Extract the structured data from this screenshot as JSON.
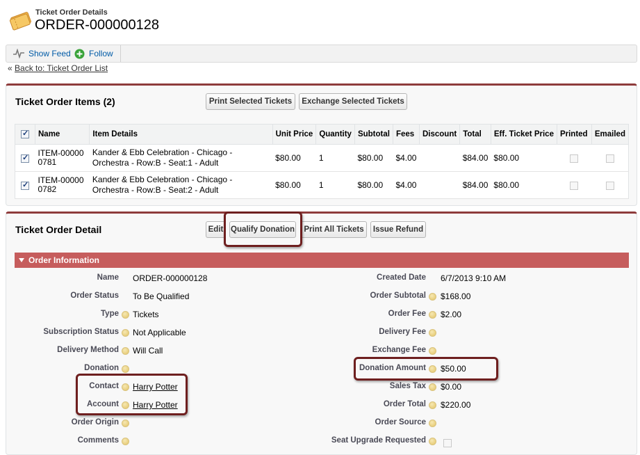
{
  "header": {
    "subtitle": "Ticket Order Details",
    "title": "ORDER-000000128"
  },
  "feedbar": {
    "show_feed": "Show Feed",
    "follow": "Follow"
  },
  "back_link": {
    "prefix": "« ",
    "label": "Back to: Ticket Order List"
  },
  "items_panel": {
    "title": "Ticket Order Items (2)",
    "print_button": "Print Selected Tickets",
    "exchange_button": "Exchange Selected Tickets",
    "columns": [
      "Name",
      "Item Details",
      "Unit Price",
      "Quantity",
      "Subtotal",
      "Fees",
      "Discount",
      "Total",
      "Eff. Ticket Price",
      "Printed",
      "Emailed"
    ],
    "rows": [
      {
        "name": "ITEM-000000781",
        "details": "Kander & Ebb Celebration - Chicago - Orchestra - Row:B - Seat:1 - Adult",
        "unit_price": "$80.00",
        "quantity": "1",
        "subtotal": "$80.00",
        "fees": "$4.00",
        "discount": "",
        "total": "$84.00",
        "eff_price": "$80.00"
      },
      {
        "name": "ITEM-000000782",
        "details": "Kander & Ebb Celebration - Chicago - Orchestra - Row:B - Seat:2 - Adult",
        "unit_price": "$80.00",
        "quantity": "1",
        "subtotal": "$80.00",
        "fees": "$4.00",
        "discount": "",
        "total": "$84.00",
        "eff_price": "$80.00"
      }
    ]
  },
  "detail_panel": {
    "title": "Ticket Order Detail",
    "edit_button": "Edit",
    "qualify_button": "Qualify Donation",
    "print_all_button": "Print All Tickets",
    "refund_button": "Issue Refund",
    "section_title": "Order Information",
    "left_fields": [
      {
        "label": "Name",
        "value": "ORDER-000000128"
      },
      {
        "label": "Order Status",
        "value": "To Be Qualified"
      },
      {
        "label": "Type",
        "value": "Tickets"
      },
      {
        "label": "Subscription Status",
        "value": "Not Applicable"
      },
      {
        "label": "Delivery Method",
        "value": "Will Call"
      },
      {
        "label": "Donation",
        "value": ""
      },
      {
        "label": "Contact",
        "value": "Harry Potter"
      },
      {
        "label": "Account",
        "value": "Harry Potter"
      },
      {
        "label": "Order Origin",
        "value": ""
      },
      {
        "label": "Comments",
        "value": ""
      }
    ],
    "right_fields": [
      {
        "label": "Created Date",
        "value": "6/7/2013 9:10 AM"
      },
      {
        "label": "Order Subtotal",
        "value": "$168.00"
      },
      {
        "label": "Order Fee",
        "value": "$2.00"
      },
      {
        "label": "Delivery Fee",
        "value": ""
      },
      {
        "label": "Exchange Fee",
        "value": ""
      },
      {
        "label": "Donation Amount",
        "value": "$50.00"
      },
      {
        "label": "Sales Tax",
        "value": "$0.00"
      },
      {
        "label": "Order Total",
        "value": "$220.00"
      },
      {
        "label": "Order Source",
        "value": ""
      },
      {
        "label": "Seat Upgrade Requested",
        "value": ""
      }
    ]
  },
  "colors": {
    "accent": "#8e3b3b",
    "section_header": "#c65d5d",
    "highlight_border": "#6e1f1f",
    "link": "#015ba7"
  },
  "icons": {
    "header": "ticket-icon",
    "show_feed": "pulse-icon",
    "follow": "plus-circle-icon",
    "help": "help-icon"
  }
}
